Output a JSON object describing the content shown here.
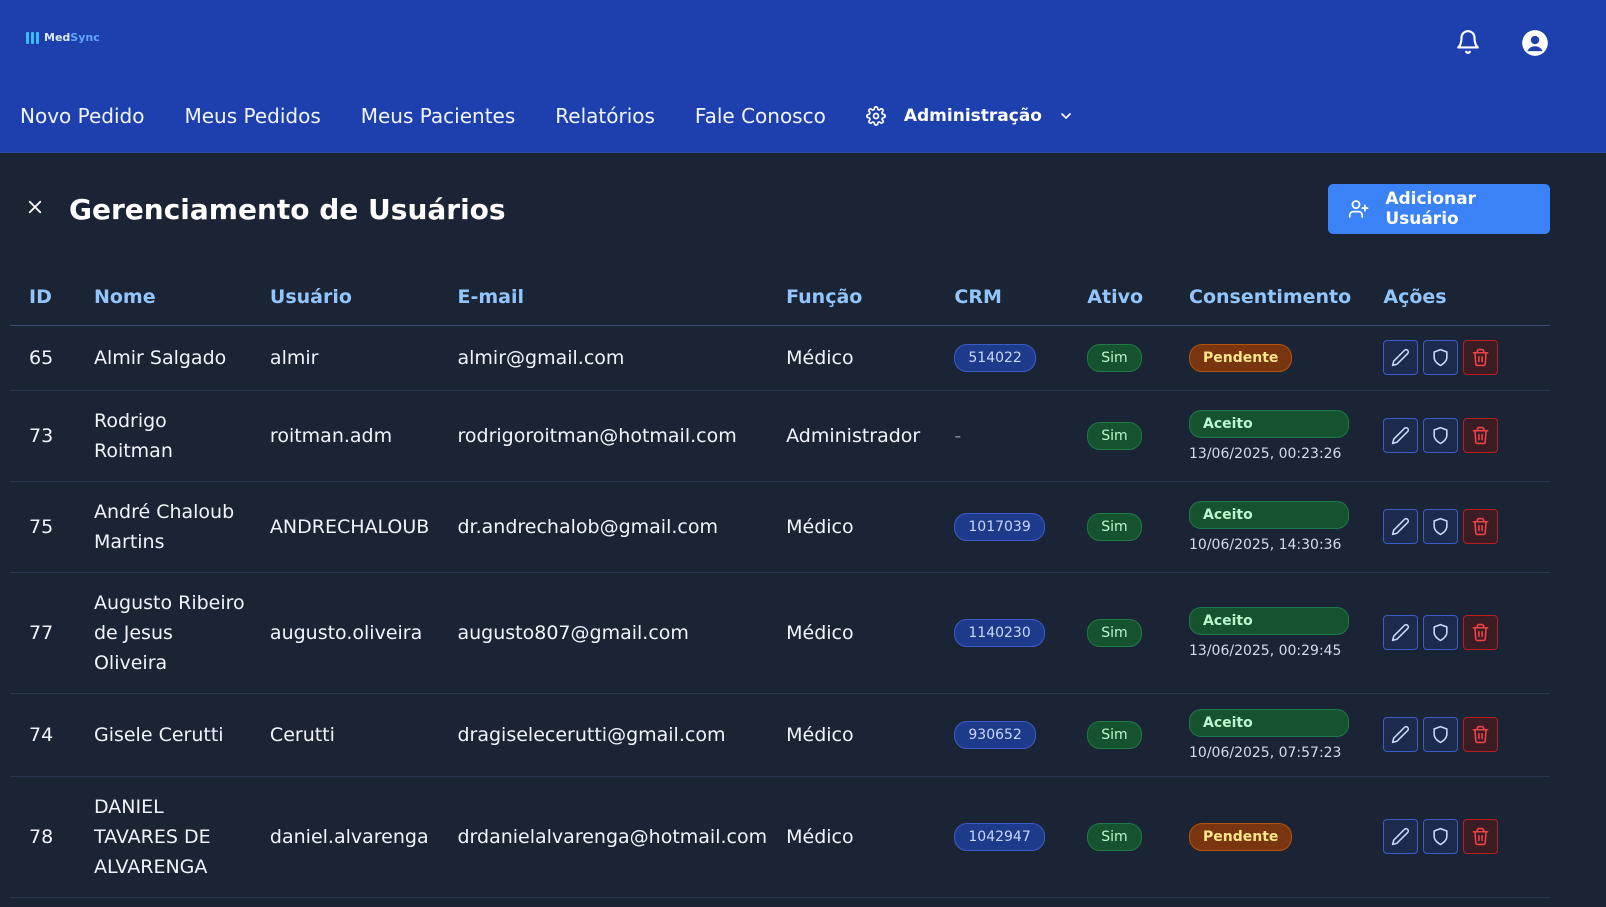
{
  "app": {
    "logo_text_1": "Med",
    "logo_text_2": "Sync"
  },
  "nav": {
    "items": [
      "Novo Pedido",
      "Meus Pedidos",
      "Meus Pacientes",
      "Relatórios",
      "Fale Conosco"
    ],
    "admin_label": "Administração"
  },
  "icons": {
    "notifications": "bell-icon",
    "account": "user-circle-icon",
    "settings": "gear-icon"
  },
  "page": {
    "title": "Gerenciamento de Usuários",
    "add_button": "Adicionar Usuário"
  },
  "table": {
    "headers": [
      "ID",
      "Nome",
      "Usuário",
      "E-mail",
      "Função",
      "CRM",
      "Ativo",
      "Consentimento",
      "Ações"
    ],
    "rows": [
      {
        "id": "65",
        "nome": "Almir Salgado",
        "usuario": "almir",
        "email": "almir@gmail.com",
        "funcao": "Médico",
        "crm": "514022",
        "ativo": "Sim",
        "consentimento": "Pendente",
        "data": ""
      },
      {
        "id": "73",
        "nome": "Rodrigo Roitman",
        "usuario": "roitman.adm",
        "email": "rodrigoroitman@hotmail.com",
        "funcao": "Administrador",
        "crm": "-",
        "ativo": "Sim",
        "consentimento": "Aceito",
        "data": "13/06/2025, 00:23:26"
      },
      {
        "id": "75",
        "nome": "André Chaloub Martins",
        "usuario": "ANDRECHALOUB",
        "email": "dr.andrechalob@gmail.com",
        "funcao": "Médico",
        "crm": "1017039",
        "ativo": "Sim",
        "consentimento": "Aceito",
        "data": "10/06/2025, 14:30:36"
      },
      {
        "id": "77",
        "nome": "Augusto Ribeiro de Jesus Oliveira",
        "usuario": "augusto.oliveira",
        "email": "augusto807@gmail.com",
        "funcao": "Médico",
        "crm": "1140230",
        "ativo": "Sim",
        "consentimento": "Aceito",
        "data": "13/06/2025, 00:29:45"
      },
      {
        "id": "74",
        "nome": "Gisele Cerutti",
        "usuario": "Cerutti",
        "email": "dragiselecerutti@gmail.com",
        "funcao": "Médico",
        "crm": "930652",
        "ativo": "Sim",
        "consentimento": "Aceito",
        "data": "10/06/2025, 07:57:23"
      },
      {
        "id": "78",
        "nome": "DANIEL TAVARES DE ALVARENGA",
        "usuario": "daniel.alvarenga",
        "email": "drdanielalvarenga@hotmail.com",
        "funcao": "Médico",
        "crm": "1042947",
        "ativo": "Sim",
        "consentimento": "Pendente",
        "data": ""
      }
    ]
  },
  "colors": {
    "topbar": "#1e40af",
    "background": "#1b2435",
    "accent": "#3b82f6",
    "header_text": "#93c5fd"
  }
}
